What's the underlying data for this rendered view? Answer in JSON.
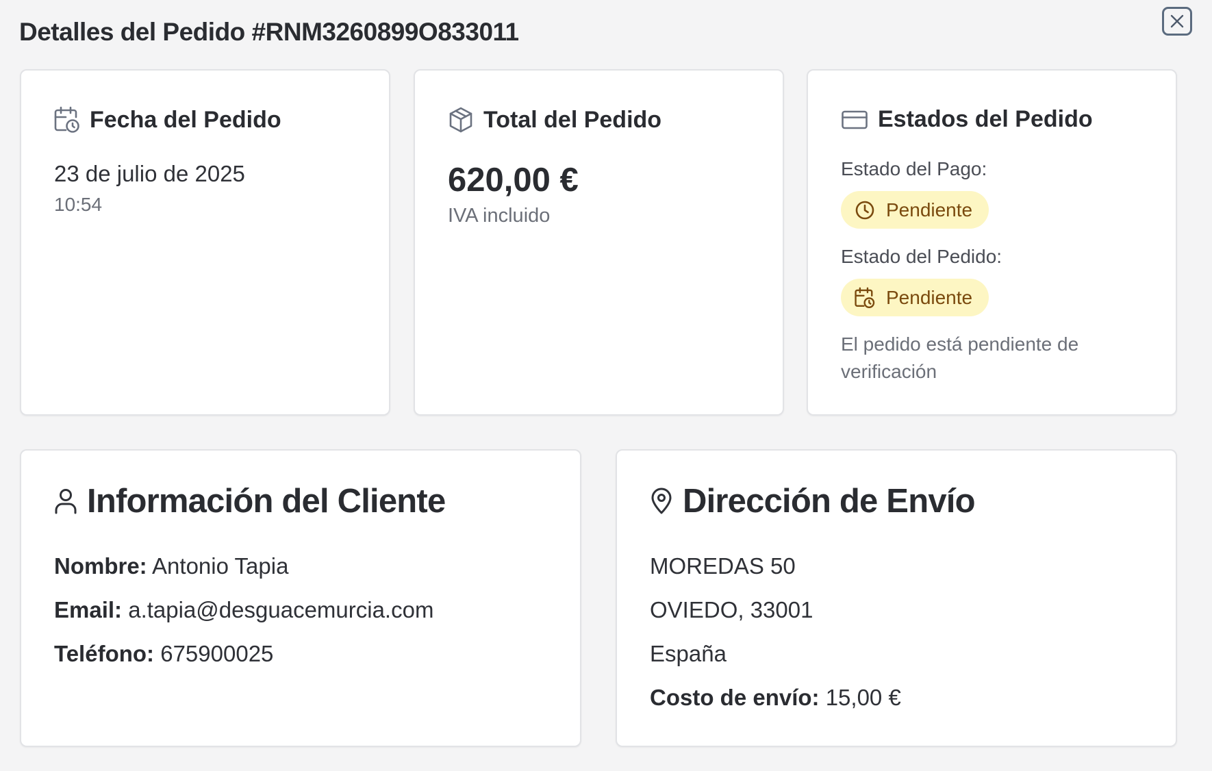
{
  "modal": {
    "title": "Detalles del Pedido #RNM3260899O833011",
    "close_icon": "close-icon"
  },
  "date_card": {
    "title": "Fecha del Pedido",
    "icon": "calendar-clock-icon",
    "date": "23 de julio de 2025",
    "time": "10:54"
  },
  "total_card": {
    "title": "Total del Pedido",
    "icon": "package-icon",
    "amount": "620,00 €",
    "note": "IVA incluido"
  },
  "status_card": {
    "title": "Estados del Pedido",
    "icon": "credit-card-icon",
    "payment_label": "Estado del Pago:",
    "payment_status": "Pendiente",
    "payment_icon": "clock-icon",
    "order_label": "Estado del Pedido:",
    "order_status": "Pendiente",
    "order_icon": "calendar-clock-icon",
    "note": "El pedido está pendiente de verificación"
  },
  "customer_card": {
    "title": "Información del Cliente",
    "icon": "user-icon",
    "name_label": "Nombre:",
    "name_value": "Antonio Tapia",
    "email_label": "Email:",
    "email_value": "a.tapia@desguacemurcia.com",
    "phone_label": "Teléfono:",
    "phone_value": "675900025"
  },
  "shipping_card": {
    "title": "Dirección de Envío",
    "icon": "map-pin-icon",
    "address_line1": "MOREDAS 50",
    "address_line2": "OVIEDO, 33001",
    "country": "España",
    "shipping_cost_label": "Costo de envío:",
    "shipping_cost_value": "15,00 €"
  },
  "colors": {
    "background": "#f4f4f5",
    "card": "#ffffff",
    "badge_bg": "#fdf6c3",
    "badge_text": "#7a4a0e",
    "heading": "#2a2c31",
    "muted": "#6b6f78"
  }
}
